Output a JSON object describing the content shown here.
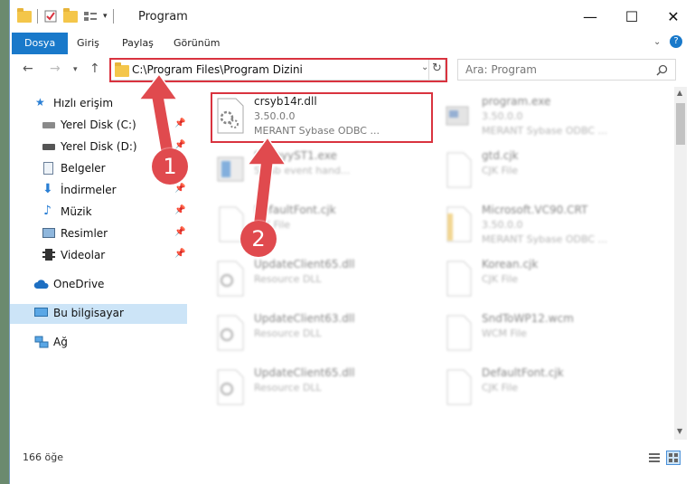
{
  "window": {
    "title": "Program",
    "minimize_glyph": "—",
    "maximize_glyph": "☐",
    "close_glyph": "✕"
  },
  "ribbon": {
    "tabs": [
      {
        "label": "Dosya",
        "active": true
      },
      {
        "label": "Giriş",
        "active": false
      },
      {
        "label": "Paylaş",
        "active": false
      },
      {
        "label": "Görünüm",
        "active": false
      }
    ]
  },
  "address": {
    "path": "C:\\Program Files\\Program Dizini",
    "search_placeholder": "Ara: Program"
  },
  "sidebar": {
    "items": [
      {
        "label": "Hızlı erişim",
        "icon": "star-icon",
        "pinned": false
      },
      {
        "label": "Yerel Disk (C:)",
        "icon": "drive-icon",
        "pinned": true
      },
      {
        "label": "Yerel Disk (D:)",
        "icon": "drive-icon",
        "pinned": true
      },
      {
        "label": "Belgeler",
        "icon": "documents-icon",
        "pinned": true
      },
      {
        "label": "İndirmeler",
        "icon": "download-icon",
        "pinned": true
      },
      {
        "label": "Müzik",
        "icon": "music-icon",
        "pinned": true
      },
      {
        "label": "Resimler",
        "icon": "pictures-icon",
        "pinned": true
      },
      {
        "label": "Videolar",
        "icon": "videos-icon",
        "pinned": true
      },
      {
        "label": "OneDrive",
        "icon": "cloud-icon",
        "pinned": false
      },
      {
        "label": "Bu bilgisayar",
        "icon": "computer-icon",
        "pinned": false,
        "selected": true
      },
      {
        "label": "Ağ",
        "icon": "network-icon",
        "pinned": false
      }
    ]
  },
  "files": [
    {
      "name": "crsyb14r.dll",
      "line2": "3.50.0.0",
      "line3": "MERANT Sybase ODBC ...",
      "highlight": true
    },
    {
      "name": "program.exe",
      "line2": "3.50.0.0",
      "line3": "MERANT Sybase ODBC ..."
    },
    {
      "name": "SybbyyST1.exe",
      "line2": "SY sb event hand...",
      "line3": ""
    },
    {
      "name": "gtd.cjk",
      "line2": "CJK File",
      "line3": ""
    },
    {
      "name": "DefaultFont.cjk",
      "line2": "CJK File",
      "line3": ""
    },
    {
      "name": "Microsoft.VC90.CRT",
      "line2": "3.50.0.0",
      "line3": "MERANT Sybase ODBC ..."
    },
    {
      "name": "UpdateClient65.dll",
      "line2": "Resource DLL",
      "line3": ""
    },
    {
      "name": "Korean.cjk",
      "line2": "CJK File",
      "line3": ""
    },
    {
      "name": "UpdateClient63.dll",
      "line2": "Resource DLL",
      "line3": ""
    },
    {
      "name": "SndToWP12.wcm",
      "line2": "WCM File",
      "line3": ""
    },
    {
      "name": "UpdateClient65.dll",
      "line2": "Resource DLL",
      "line3": ""
    },
    {
      "name": "DefaultFont.cjk",
      "line2": "CJK File",
      "line3": ""
    }
  ],
  "status": {
    "item_count": "166 öğe"
  },
  "annotations": {
    "step1": "1",
    "step2": "2"
  },
  "colors": {
    "accent": "#1979ca",
    "highlight_red": "#d9333f",
    "badge_red": "#e04a4e",
    "selected_bg": "#cce4f7"
  }
}
